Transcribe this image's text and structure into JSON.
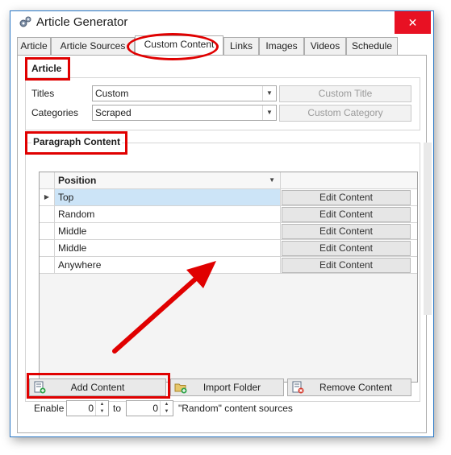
{
  "window": {
    "title": "Article Generator",
    "close_glyph": "✕"
  },
  "tabs": [
    {
      "label": "Article"
    },
    {
      "label": "Article Sources"
    },
    {
      "label": "Custom Content"
    },
    {
      "label": "Links"
    },
    {
      "label": "Images"
    },
    {
      "label": "Videos"
    },
    {
      "label": "Schedule"
    }
  ],
  "article": {
    "title": "Article",
    "titles_label": "Titles",
    "titles_value": "Custom",
    "categories_label": "Categories",
    "categories_value": "Scraped",
    "custom_title_button": "Custom Title",
    "custom_category_button": "Custom Category"
  },
  "paragraph": {
    "title": "Paragraph Content",
    "column_position": "Position",
    "rows": [
      {
        "position": "Top",
        "action": "Edit Content"
      },
      {
        "position": "Random",
        "action": "Edit Content"
      },
      {
        "position": "Middle",
        "action": "Edit Content"
      },
      {
        "position": "Middle",
        "action": "Edit Content"
      },
      {
        "position": "Anywhere",
        "action": "Edit Content"
      }
    ],
    "selected_row": 0,
    "add_button": "Add Content",
    "import_button": "Import Folder",
    "remove_button": "Remove Content"
  },
  "enable": {
    "label": "Enable",
    "from_value": "0",
    "to_label": "to",
    "to_value": "0",
    "suffix": "\"Random\" content sources"
  },
  "colors": {
    "annotation_red": "#e00000",
    "selection": "#cce4f7",
    "close_red": "#e81123"
  }
}
